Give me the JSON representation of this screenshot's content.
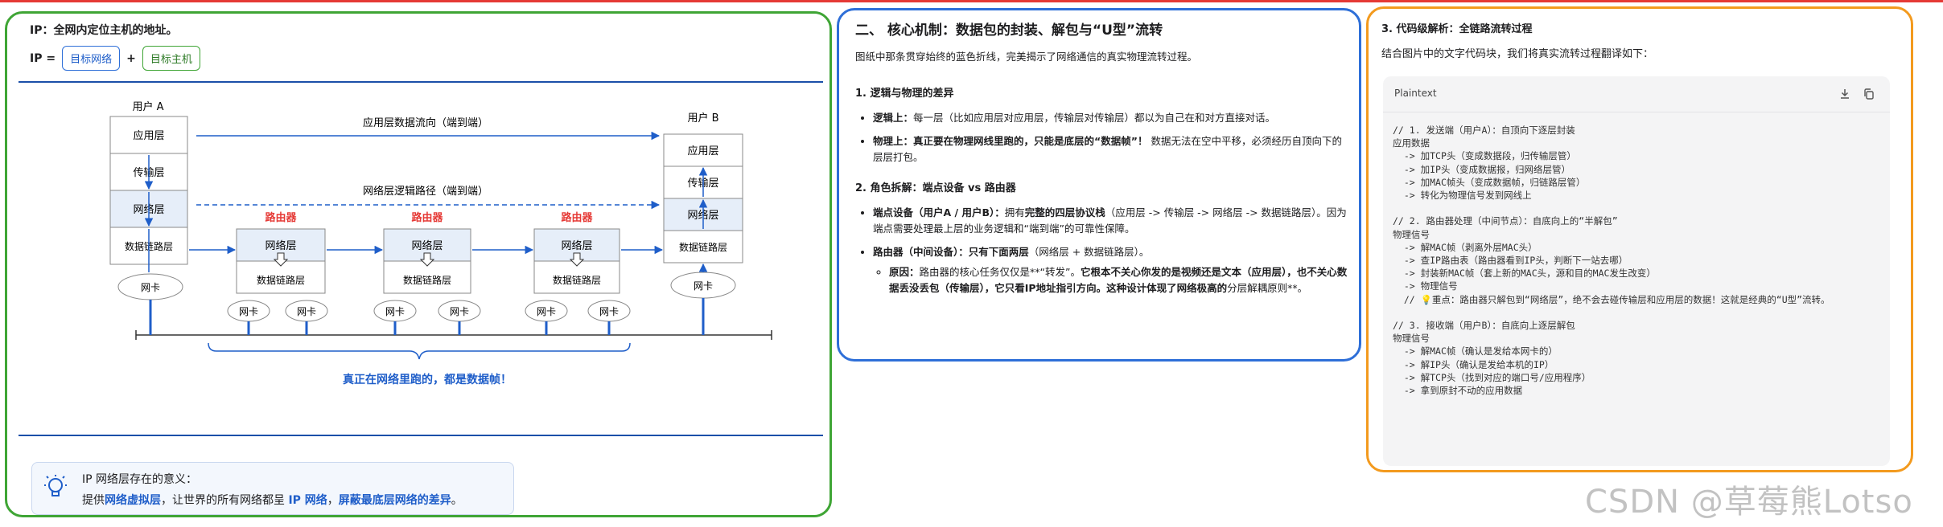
{
  "panel1": {
    "ip_label": "IP：",
    "ip_definition": "全网内定位主机的地址。",
    "eq_ip": "IP =",
    "eq_net": "目标网络",
    "eq_plus": "+",
    "eq_host": "目标主机",
    "diagram": {
      "user_a": "用户 A",
      "user_b": "用户 B",
      "layer_app": "应用层",
      "layer_transport": "传输层",
      "layer_network": "网络层",
      "layer_datalink": "数据链路层",
      "nic": "网卡",
      "router": "路由器",
      "app_flow": "应用层数据流向（端到端）",
      "net_path": "网络层逻辑路径（端到端）",
      "bottom_caption": "真正在网络里跑的，都是数据帧！"
    },
    "tip_title": "IP 网络层存在的意义：",
    "tip_pre": "提供",
    "tip_hl1": "网络虚拟层",
    "tip_mid": "，让世界的所有网络都呈",
    "tip_hl2": "IP 网络",
    "tip_sep": "，",
    "tip_hl3": "屏蔽最底层网络的差异",
    "tip_end": "。"
  },
  "panel2": {
    "title": "二、 核心机制：数据包的封装、解包与“U型”流转",
    "intro": "图纸中那条贯穿始终的蓝色折线，完美揭示了网络通信的真实物理流转过程。",
    "s1_title": "1. 逻辑与物理的差异",
    "s1_b1_label": "逻辑上：",
    "s1_b1_text": "每一层（比如应用层对应用层，传输层对传输层）都以为自己在和对方直接对话。",
    "s1_b2_label": "物理上：",
    "s1_b2_bold": "真正要在物理网线里跑的，只能是底层的“数据帧”！",
    "s1_b2_text": "数据无法在空中平移，必须经历自顶向下的层层打包。",
    "s2_title": "2. 角色拆解：端点设备 vs 路由器",
    "s2_b1_label": "端点设备（用户A / 用户B）：",
    "s2_b1_pre": "拥有",
    "s2_b1_bold": "完整的四层协议栈",
    "s2_b1_text": "（应用层 -> 传输层 -> 网络层 -> 数据链路层）。因为端点需要处理最上层的业务逻辑和“端到端”的可靠性保障。",
    "s2_b2_label": "路由器（中间设备）：只有下面两层",
    "s2_b2_text": "（网络层 + 数据链路层）。",
    "s2_sub_label": "原因：",
    "s2_sub_text": "路由器的核心任务仅仅是**“转发”。",
    "s2_sub_bold": "它根本不关心你发的是视频还是文本（应用层），也不关心数据丢没丢包（传输层），它只看IP地址指引方向。这种设计体现了网络极高的",
    "s2_sub_end": "分层解耦原则**。"
  },
  "panel3": {
    "title": "3. 代码级解析：全链路流转过程",
    "intro": "结合图片中的文字代码块，我们将真实流转过程翻译如下：",
    "lang": "Plaintext",
    "code": "// 1. 发送端（用户A）：自顶向下逐层封装\n应用数据\n  -> 加TCP头（变成数据段，归传输层管）\n  -> 加IP头（变成数据报，归网络层管）\n  -> 加MAC帧头（变成数据帧，归链路层管）\n  -> 转化为物理信号发到网线上\n\n// 2. 路由器处理（中间节点）：自底向上的“半解包”\n物理信号\n  -> 解MAC帧（剥离外层MAC头）\n  -> 查IP路由表（路由器看到IP头，判断下一站去哪）\n  -> 封装新MAC帧（套上新的MAC头，源和目的MAC发生改变）\n  -> 物理信号\n  // 💡重点：路由器只解包到“网络层”，绝不会去碰传输层和应用层的数据！这就是经典的“U型”流转。\n\n// 3. 接收端（用户B）：自底向上逐层解包\n物理信号\n  -> 解MAC帧（确认是发给本网卡的）\n  -> 解IP头（确认是发给本机的IP）\n  -> 解TCP头（找到对应的端口号/应用程序）\n  -> 拿到原封不动的应用数据"
  },
  "watermark": "CSDN @草莓熊Lotso",
  "colors": {
    "green_border": "#3fa535",
    "blue_border": "#2e6fd8",
    "orange_border": "#f39a1e",
    "flow_blue": "#1f5ec9",
    "router_red": "#e53935"
  },
  "icons": [
    "lightbulb-icon",
    "download-icon",
    "copy-icon"
  ]
}
